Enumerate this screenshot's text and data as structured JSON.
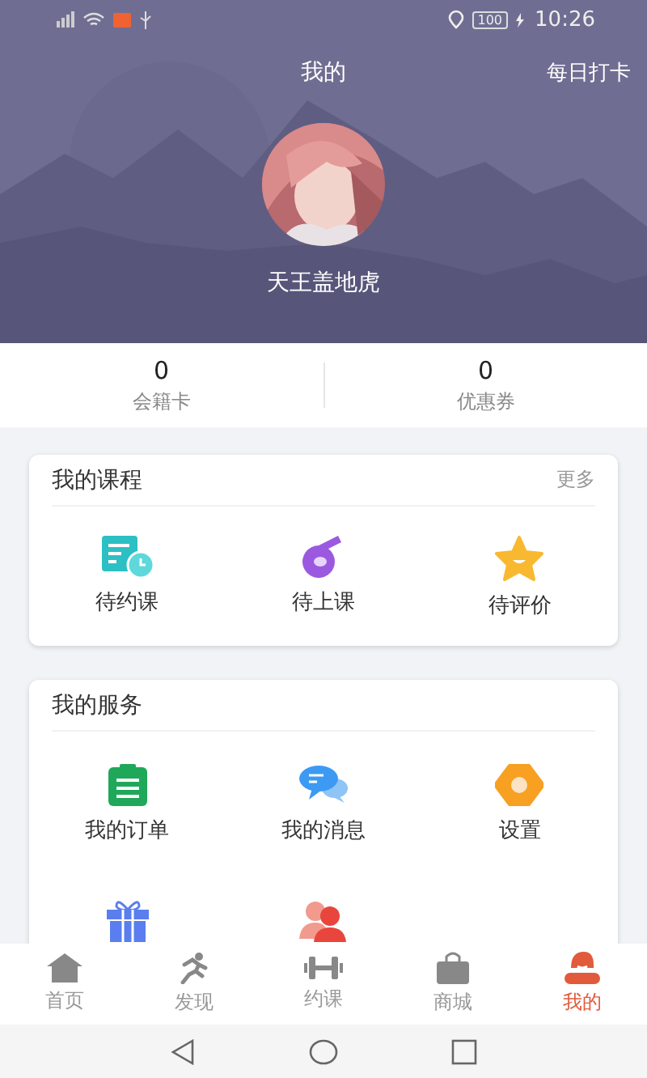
{
  "status_bar": {
    "battery": "100",
    "time": "10:26"
  },
  "header": {
    "title": "我的",
    "action": "每日打卡",
    "username": "天王盖地虎"
  },
  "stats": [
    {
      "value": "0",
      "label": "会籍卡"
    },
    {
      "value": "0",
      "label": "优惠券"
    }
  ],
  "courses": {
    "title": "我的课程",
    "more": "更多",
    "items": [
      {
        "kind": "schedule",
        "label": "待约课"
      },
      {
        "kind": "whistle",
        "label": "待上课"
      },
      {
        "kind": "star",
        "label": "待评价"
      }
    ]
  },
  "services": {
    "title": "我的服务",
    "items": [
      {
        "kind": "order",
        "label": "我的订单"
      },
      {
        "kind": "message",
        "label": "我的消息"
      },
      {
        "kind": "settings",
        "label": "设置"
      },
      {
        "kind": "gift"
      },
      {
        "kind": "people"
      }
    ]
  },
  "tabs": [
    {
      "kind": "home",
      "label": "首页",
      "selected": false
    },
    {
      "kind": "run",
      "label": "发现",
      "selected": false
    },
    {
      "kind": "dumbbell",
      "label": "约课",
      "selected": false
    },
    {
      "kind": "bag",
      "label": "商城",
      "selected": false
    },
    {
      "kind": "me",
      "label": "我的",
      "selected": true
    }
  ]
}
